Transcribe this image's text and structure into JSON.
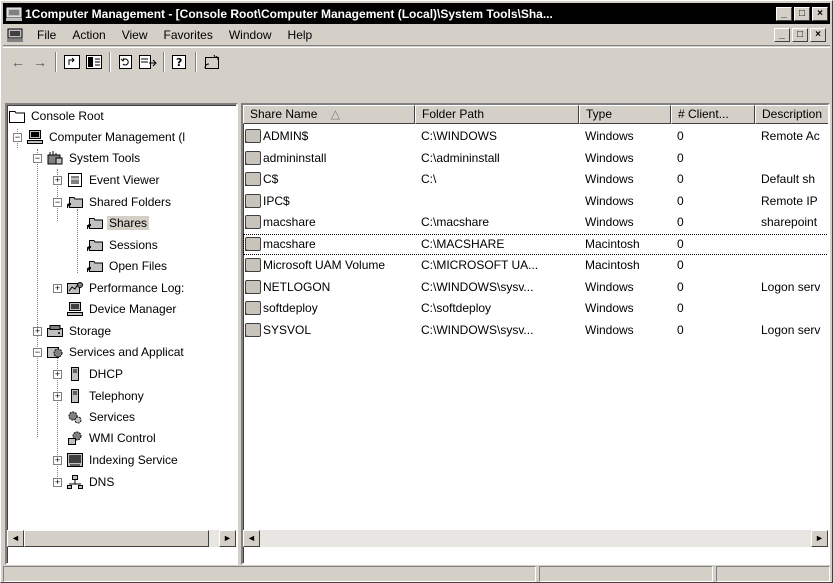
{
  "window": {
    "title": "1Computer Management - [Console Root\\Computer Management (Local)\\System Tools\\Sha...",
    "min_label": "_",
    "max_label": "□",
    "close_label": "×"
  },
  "menu": {
    "items": [
      "File",
      "Action",
      "View",
      "Favorites",
      "Window",
      "Help"
    ]
  },
  "toolbar": {
    "back_icon": "←",
    "forward_icon": "→"
  },
  "tree": {
    "nodes": [
      "Console Root",
      "Computer Management (l",
      "System Tools",
      "Event Viewer",
      "Shared Folders",
      "Shares",
      "Sessions",
      "Open Files",
      "Performance Log:",
      "Device Manager",
      "Storage",
      "Services and Applicat",
      "DHCP",
      "Telephony",
      "Services",
      "WMI Control",
      "Indexing Service",
      "DNS"
    ],
    "selected": "Shares"
  },
  "list": {
    "columns": [
      "Share Name",
      "Folder Path",
      "Type",
      "# Client...",
      "Description"
    ],
    "sort_indicator": "△",
    "rows": [
      [
        "ADMIN$",
        "C:\\WINDOWS",
        "Windows",
        "0",
        "Remote Ac"
      ],
      [
        "admininstall",
        "C:\\admininstall",
        "Windows",
        "0",
        ""
      ],
      [
        "C$",
        "C:\\",
        "Windows",
        "0",
        "Default sh"
      ],
      [
        "IPC$",
        "",
        "Windows",
        "0",
        "Remote IP"
      ],
      [
        "macshare",
        "C:\\macshare",
        "Windows",
        "0",
        "sharepoint"
      ],
      [
        "macshare",
        "C:\\MACSHARE",
        "Macintosh",
        "0",
        ""
      ],
      [
        "Microsoft UAM Volume",
        "C:\\MICROSOFT UA...",
        "Macintosh",
        "0",
        ""
      ],
      [
        "NETLOGON",
        "C:\\WINDOWS\\sysv...",
        "Windows",
        "0",
        "Logon serv"
      ],
      [
        "softdeploy",
        "C:\\softdeploy",
        "Windows",
        "0",
        ""
      ],
      [
        "SYSVOL",
        "C:\\WINDOWS\\sysv...",
        "Windows",
        "0",
        "Logon serv"
      ]
    ],
    "focused_row": 5
  },
  "scroll": {
    "left_arrow": "◄",
    "right_arrow": "►"
  }
}
